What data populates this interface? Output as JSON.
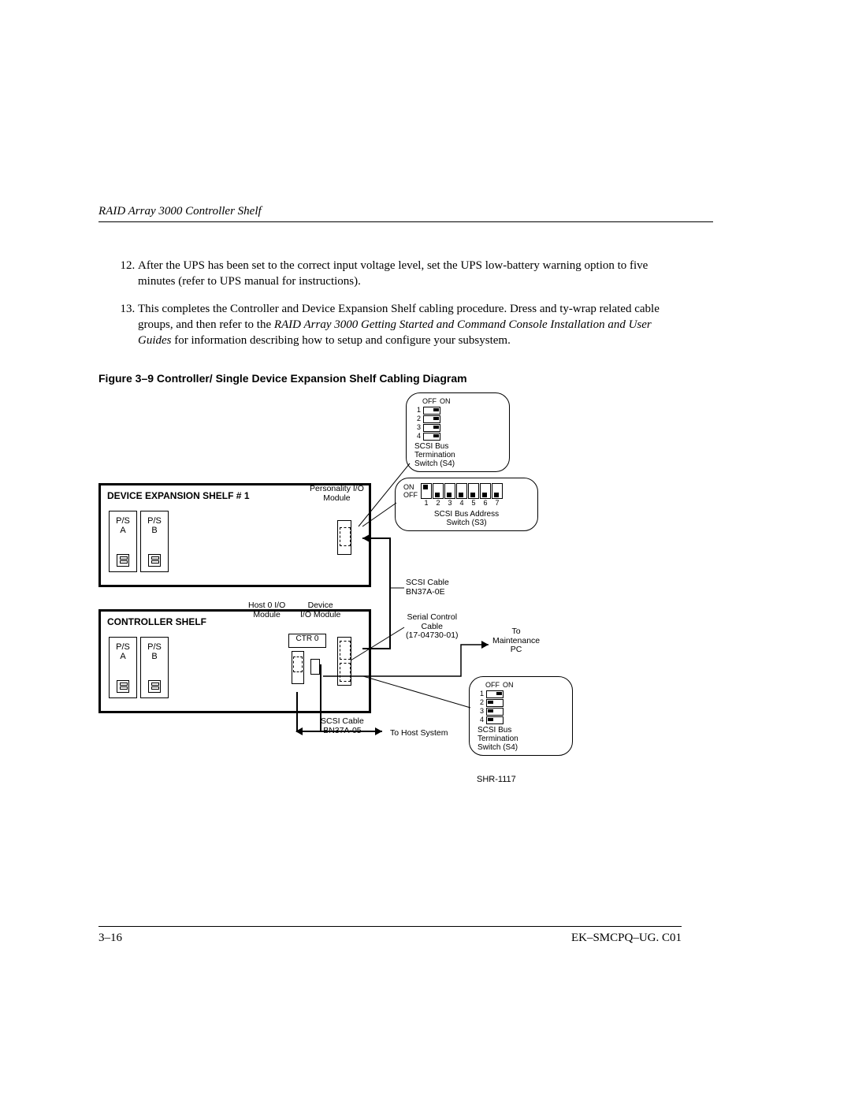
{
  "header": {
    "running_title": "RAID Array 3000 Controller Shelf"
  },
  "steps": {
    "start": 12,
    "items": [
      {
        "text": "After the UPS has been set to the correct input voltage level, set the UPS low-battery warning option to five minutes (refer to UPS manual for instructions)."
      },
      {
        "text_a": "This completes the Controller and Device Expansion Shelf cabling procedure. Dress and ty-wrap related cable groups, and then refer to the ",
        "text_em": "RAID Array 3000 Getting Started and Command Console Installation and User Guides",
        "text_b": " for information describing how to setup and configure your subsystem."
      }
    ]
  },
  "figure": {
    "caption": "Figure 3–9  Controller/ Single Device Expansion Shelf Cabling Diagram",
    "dev_shelf_title": "DEVICE EXPANSION SHELF # 1",
    "ctrl_shelf_title": "CONTROLLER SHELF",
    "ps_a": "P/S\nA",
    "ps_b": "P/S\nB",
    "personality_io": "Personality I/O\nModule",
    "host0_io": "Host 0 I/O\nModule",
    "device_io": "Device\nI/O Module",
    "ctr0": "CTR 0",
    "scsi_cable_top": "SCSI Cable\nBN37A-0E",
    "scsi_cable_bottom": "SCSI Cable\nBN37A-05",
    "serial_cable": "Serial Control\nCable\n(17-04730-01)",
    "to_maint": "To\nMaintenance\nPC",
    "to_host": "To Host System",
    "dwg_no": "SHR-1117",
    "callout_s4": {
      "off": "OFF",
      "on": "ON",
      "label": "SCSI Bus\nTermination\nSwitch (S4)",
      "rows": [
        "1",
        "2",
        "3",
        "4"
      ],
      "states_top": [
        "on",
        "on",
        "on",
        "on"
      ],
      "states_bottom": [
        "on",
        "off",
        "off",
        "off"
      ]
    },
    "callout_s3": {
      "on": "ON",
      "off": "OFF",
      "label": "SCSI Bus Address\nSwitch (S3)",
      "cols": [
        "1",
        "2",
        "3",
        "4",
        "5",
        "6",
        "7"
      ],
      "states": [
        "up",
        "down",
        "down",
        "down",
        "down",
        "down",
        "down"
      ]
    }
  },
  "footer": {
    "page": "3–16",
    "doc": "EK–SMCPQ–UG. C01"
  }
}
